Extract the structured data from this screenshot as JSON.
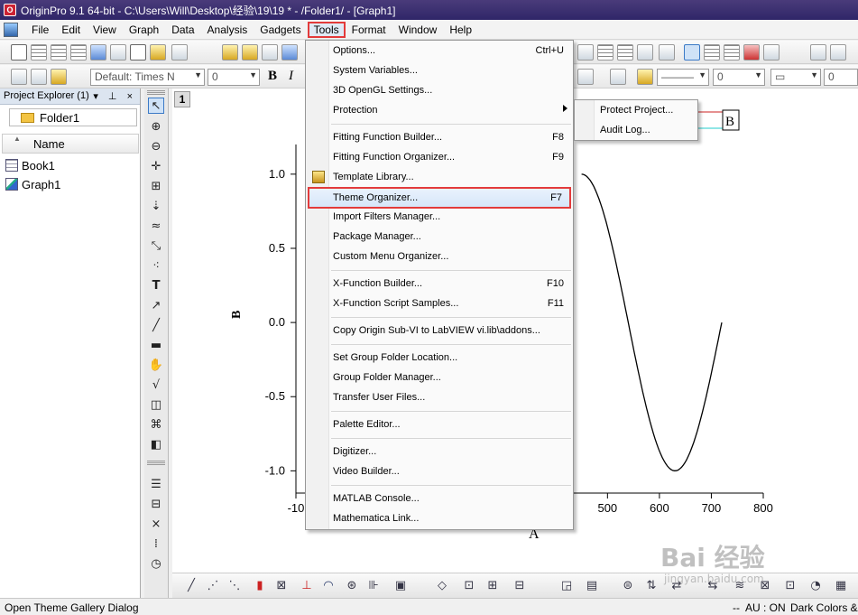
{
  "window": {
    "title": "OriginPro 9.1 64-bit - C:\\Users\\Will\\Desktop\\经验\\19\\19 * - /Folder1/ - [Graph1]"
  },
  "menubar": {
    "items": [
      "File",
      "Edit",
      "View",
      "Graph",
      "Data",
      "Analysis",
      "Gadgets",
      "Tools",
      "Format",
      "Window",
      "Help"
    ],
    "active": "Tools"
  },
  "format_toolbar": {
    "font": "Default: Times N",
    "size": "0",
    "bold": "B",
    "italic": "I",
    "num_a": "0",
    "num_b": "0",
    "num_c": "0"
  },
  "project_explorer": {
    "title": "Project Explorer (1)",
    "controls": "▾ ⊥ ×",
    "folder": "Folder1",
    "column_header": "Name",
    "items": [
      {
        "name": "Book1",
        "icon": "workbook-icon"
      },
      {
        "name": "Graph1",
        "icon": "graph-icon"
      }
    ]
  },
  "graph": {
    "layer_tab": "1",
    "legend_label": "B",
    "ylabel": "B",
    "xlabel": "A"
  },
  "chart_data": {
    "type": "line",
    "title": "",
    "xlabel": "A",
    "ylabel": "B",
    "xlim": [
      -100,
      800
    ],
    "ylim": [
      -1.15,
      1.2
    ],
    "xticks_visible": [
      "-10",
      "500",
      "600",
      "700",
      "800"
    ],
    "yticks": [
      "1.0",
      "0.5",
      "0.0",
      "-0.5",
      "-1.0"
    ],
    "series": [
      {
        "name": "B",
        "x": [
          450,
          480,
          510,
          540,
          570,
          600,
          630,
          660,
          690,
          720
        ],
        "y": [
          1.0,
          0.87,
          0.5,
          0.0,
          -0.5,
          -0.87,
          -1.0,
          -0.87,
          -0.5,
          0.0
        ]
      }
    ]
  },
  "tools_menu": {
    "items": [
      {
        "label": "Options...",
        "shortcut": "Ctrl+U"
      },
      {
        "label": "System Variables...",
        "shortcut": ""
      },
      {
        "label": "3D OpenGL Settings...",
        "shortcut": ""
      },
      {
        "label": "Protection",
        "shortcut": "",
        "submenu": true
      },
      {
        "label": "Fitting Function Builder...",
        "shortcut": "F8"
      },
      {
        "label": "Fitting Function Organizer...",
        "shortcut": "F9"
      },
      {
        "label": "Template Library...",
        "shortcut": "",
        "icon": "template-library-icon"
      },
      {
        "label": "Theme Organizer...",
        "shortcut": "F7",
        "highlighted": true
      },
      {
        "label": "Import Filters Manager...",
        "shortcut": ""
      },
      {
        "label": "Package Manager...",
        "shortcut": ""
      },
      {
        "label": "Custom Menu Organizer...",
        "shortcut": ""
      },
      {
        "label": "X-Function Builder...",
        "shortcut": "F10"
      },
      {
        "label": "X-Function Script Samples...",
        "shortcut": "F11"
      },
      {
        "label": "Copy Origin Sub-VI to LabVIEW vi.lib\\addons...",
        "shortcut": ""
      },
      {
        "label": "Set Group Folder Location...",
        "shortcut": ""
      },
      {
        "label": "Group Folder Manager...",
        "shortcut": ""
      },
      {
        "label": "Transfer User Files...",
        "shortcut": ""
      },
      {
        "label": "Palette Editor...",
        "shortcut": ""
      },
      {
        "label": "Digitizer...",
        "shortcut": ""
      },
      {
        "label": "Video Builder...",
        "shortcut": ""
      },
      {
        "label": "MATLAB Console...",
        "shortcut": ""
      },
      {
        "label": "Mathematica Link...",
        "shortcut": ""
      }
    ]
  },
  "protection_submenu": {
    "items": [
      "Protect Project...",
      "Audit Log..."
    ]
  },
  "statusbar": {
    "message": "Open Theme Gallery Dialog",
    "dashes": "--",
    "au": "AU : ON",
    "theme": "Dark Colors &"
  },
  "watermark": {
    "text": "Bai 经验",
    "sub": "jingyan.baidu.com"
  },
  "colors": {
    "highlight_border": "#e33b3b",
    "titlebar": "#2f2668",
    "curve": "#000000"
  }
}
